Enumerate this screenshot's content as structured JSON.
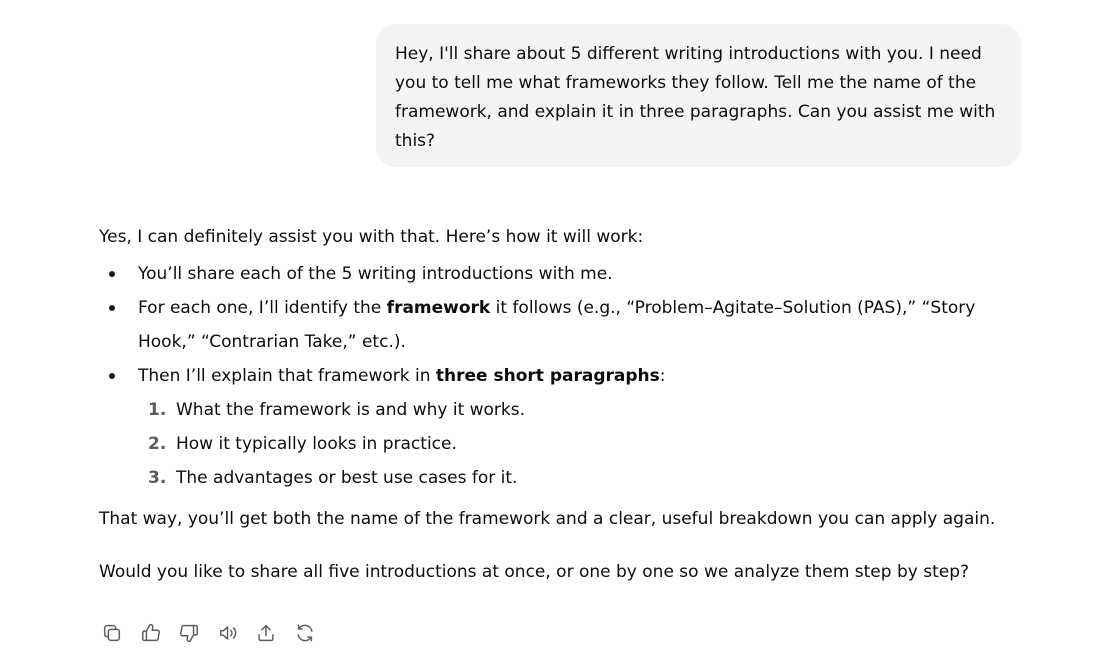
{
  "user_message": {
    "text": "Hey, I'll share about 5 different writing introductions with you. I need you to tell me what frameworks they follow. Tell me the name of the framework, and explain it in three paragraphs. Can you assist me with this?"
  },
  "assistant_message": {
    "intro": "Yes, I can definitely assist you with that. Here’s how it will work:",
    "bullet1": "You’ll share each of the 5 writing introductions with me.",
    "bullet2": {
      "before": "For each one, I’ll identify the ",
      "bold": "framework",
      "after": " it follows (e.g., “Problem–Agitate–Solution (PAS),” “Story Hook,” “Contrarian Take,” etc.)."
    },
    "bullet3": {
      "before": "Then I’ll explain that framework in ",
      "bold": "three short paragraphs",
      "after": ":"
    },
    "steps": [
      {
        "num": "1.",
        "text": "What the framework is and why it works."
      },
      {
        "num": "2.",
        "text": "How it typically looks in practice."
      },
      {
        "num": "3.",
        "text": "The advantages or best use cases for it."
      }
    ],
    "closing1": "That way, you’ll get both the name of the framework and a clear, useful breakdown you can apply again.",
    "closing2": "Would you like to share all five introductions at once, or one by one so we analyze them step by step?"
  },
  "action_bar": {
    "icons": [
      "copy-icon",
      "thumbs-up-icon",
      "thumbs-down-icon",
      "read-aloud-icon",
      "share-icon",
      "regenerate-icon"
    ],
    "icon_color": "#5d5d5d"
  },
  "colors": {
    "user_bubble_bg": "#f4f4f4",
    "text": "#0d0d0d"
  }
}
